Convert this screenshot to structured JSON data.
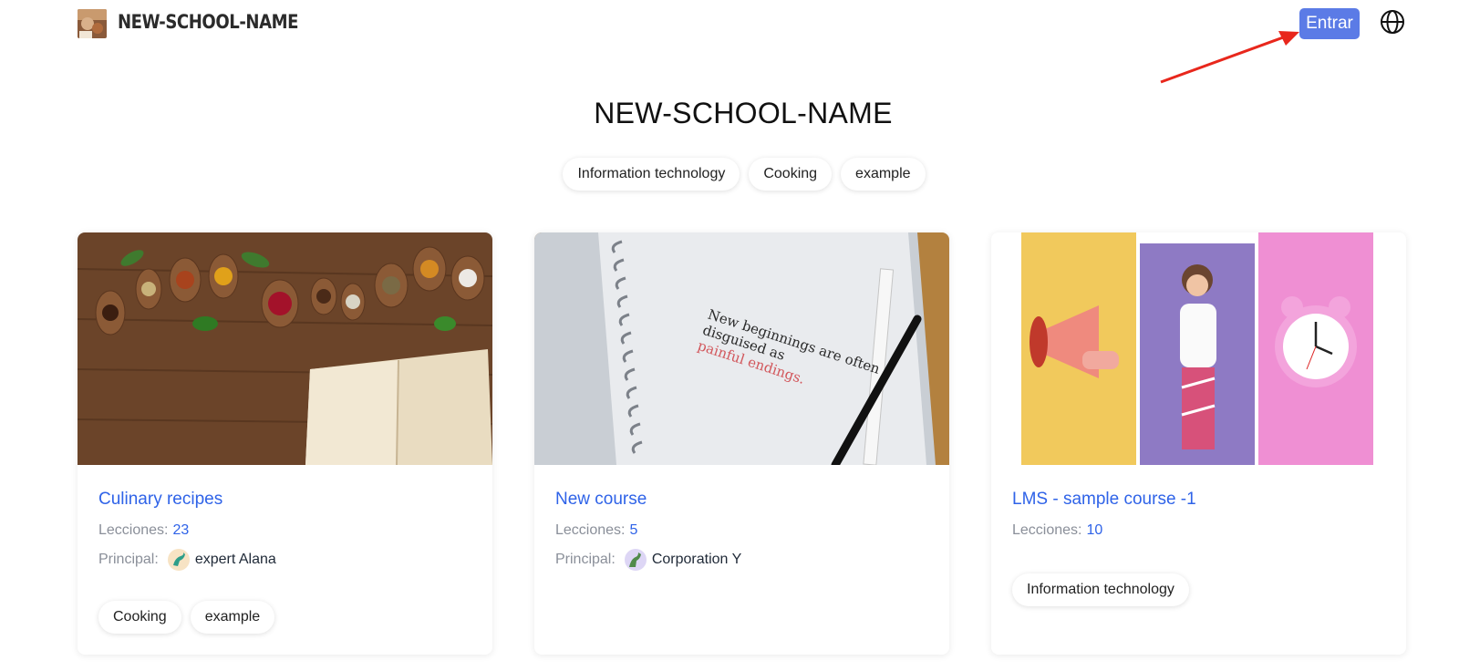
{
  "header": {
    "brand": "NEW-SCHOOL-NAME",
    "login_label": "Entrar"
  },
  "hero": {
    "title": "NEW-SCHOOL-NAME",
    "tags": [
      "Information technology",
      "Cooking",
      "example"
    ]
  },
  "courses": [
    {
      "title": "Culinary recipes",
      "lessons_label": "Lecciones:",
      "lessons": "23",
      "principal_label": "Principal:",
      "principal": "expert Alana",
      "tags": [
        "Cooking",
        "example"
      ]
    },
    {
      "title": "New course",
      "lessons_label": "Lecciones:",
      "lessons": "5",
      "principal_label": "Principal:",
      "principal": "Corporation Y",
      "notebook_line1": "New beginnings are often",
      "notebook_line2": "disguised as",
      "notebook_line3": "painful endings.",
      "tags": []
    },
    {
      "title": "LMS - sample course -1",
      "lessons_label": "Lecciones:",
      "lessons": "10",
      "tags": [
        "Information technology"
      ]
    }
  ],
  "colors": {
    "accent": "#2f63e8",
    "button": "#5b7be6",
    "annotation_arrow": "#e8271c"
  },
  "icons": {
    "globe": "globe-icon",
    "arrow": "annotation-arrow"
  }
}
